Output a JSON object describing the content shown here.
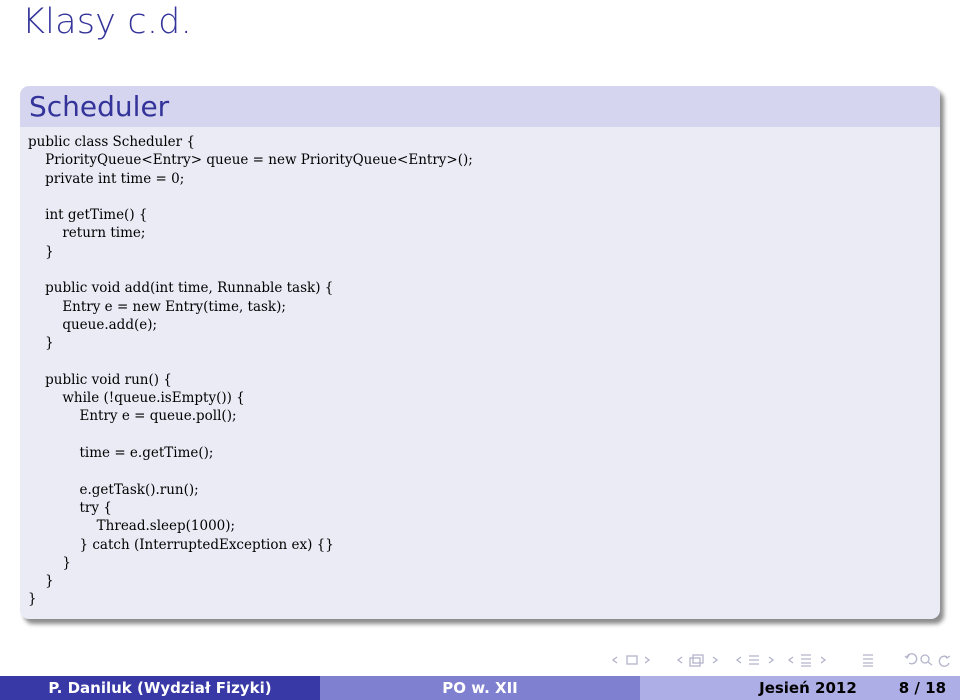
{
  "frame": {
    "title": "Klasy c.d."
  },
  "block": {
    "title": "Scheduler",
    "code_lines": [
      "public class Scheduler {",
      "    PriorityQueue<Entry> queue = new PriorityQueue<Entry>();",
      "    private int time = 0;",
      "",
      "    int getTime() {",
      "        return time;",
      "    }",
      "",
      "    public void add(int time, Runnable task) {",
      "        Entry e = new Entry(time, task);",
      "        queue.add(e);",
      "    }",
      "",
      "    public void run() {",
      "        while (!queue.isEmpty()) {",
      "            Entry e = queue.poll();",
      "",
      "            time = e.getTime();",
      "",
      "            e.getTask().run();",
      "            try {",
      "                Thread.sleep(1000);",
      "            } catch (InterruptedException ex) {}",
      "        }",
      "    }",
      "}"
    ]
  },
  "navigation": {
    "icons": [
      "nav-prev-slide",
      "slide-icon",
      "nav-next-slide",
      "nav-prev-frame",
      "frame-icon",
      "nav-next-frame",
      "nav-prev-subsection",
      "subsection-icon",
      "nav-next-subsection",
      "nav-prev-section",
      "section-icon",
      "nav-next-section",
      "document-icon",
      "back-icon",
      "search-icon",
      "forward-icon"
    ]
  },
  "footer": {
    "author": "P. Daniluk  (Wydział Fizyki)",
    "short_title": "PO w. XII",
    "date": "Jesień 2012",
    "page": "8 / 18"
  },
  "colors": {
    "title": "#33339a",
    "block_header": "#d5d5ef",
    "block_body": "#ebebf6",
    "footer_left": "#3838a6",
    "footer_mid": "#8080d0",
    "footer_right": "#aeaee6"
  }
}
